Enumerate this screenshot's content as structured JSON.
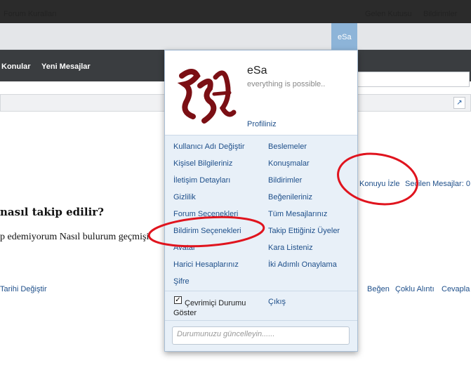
{
  "navbar": {
    "rules": "Forum Kuralları",
    "user": "eSa",
    "inbox": "Gelen Kutusu",
    "alerts": "Bildirimler"
  },
  "subnav": {
    "topics": "Konular",
    "new_posts": "Yeni Mesajlar"
  },
  "thread": {
    "watch": "Konuyu İzle",
    "selected_posts": "Seçilen Mesajlar: 0",
    "title_partial": "nasıl takip edilir?",
    "body_partial": "p edemiyorum Nasıl bulurum geçmişi",
    "date_change": "Tarihi Değiştir",
    "like": "Beğen",
    "multi_quote": "Çoklu Alıntı",
    "reply": "Cevapla"
  },
  "popup": {
    "username": "eSa",
    "user_title": "everything is possible..",
    "profile": "Profiliniz",
    "left_items": [
      "Kullanıcı Adı Değiştir",
      "Kişisel Bilgileriniz",
      "İletişim Detayları",
      "Gizlilik",
      "Forum Seçenekleri",
      "Bildirim Seçenekleri",
      "Avatar",
      "Harici Hesaplarınız",
      "Şifre"
    ],
    "right_items": [
      "Beslemeler",
      "Konuşmalar",
      "Bildirimler",
      "Beğenileriniz",
      "Tüm Mesajlarınız",
      "Takip Ettiğiniz Üyeler",
      "Kara Listeniz",
      "İki Adımlı Onaylama"
    ],
    "online_status_line1": "Çevrimiçi Durumu",
    "online_status_line2": "Göster",
    "logout": "Çıkış",
    "status_placeholder": "Durumunuzu güncelleyin......"
  },
  "colors": {
    "accent": "#8db4d8",
    "link": "#1e4f8a",
    "annotation": "#e0141e"
  }
}
